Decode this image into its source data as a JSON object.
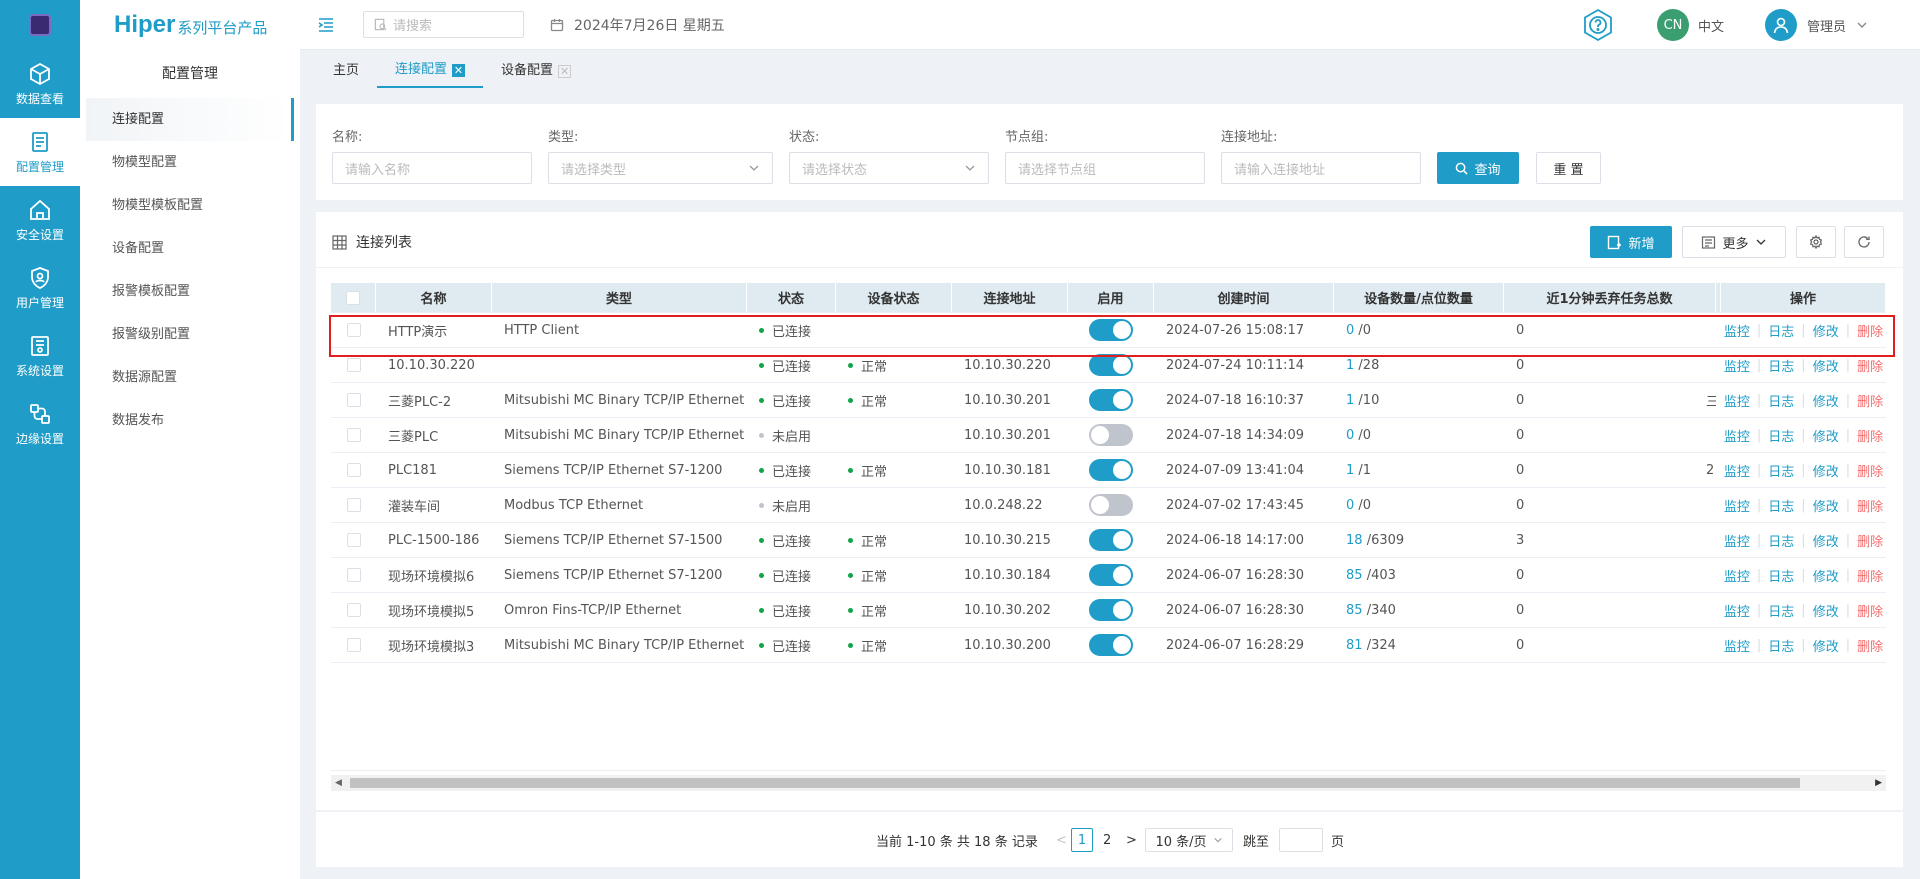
{
  "nav": {
    "items": [
      {
        "label": "数据查看",
        "icon": "cube-icon",
        "active": false
      },
      {
        "label": "配置管理",
        "icon": "config-doc-icon",
        "active": true
      },
      {
        "label": "安全设置",
        "icon": "home-shield-icon",
        "active": false
      },
      {
        "label": "用户管理",
        "icon": "user-shield-icon",
        "active": false
      },
      {
        "label": "系统设置",
        "icon": "system-settings-icon",
        "active": false
      },
      {
        "label": "边缘设置",
        "icon": "edge-network-icon",
        "active": false
      }
    ]
  },
  "brand": {
    "name": "Hiper",
    "suffix": "系列平台产品"
  },
  "submenu": {
    "title": "配置管理",
    "items": [
      "连接配置",
      "物模型配置",
      "物模型模板配置",
      "设备配置",
      "报警模板配置",
      "报警级别配置",
      "数据源配置",
      "数据发布"
    ]
  },
  "header": {
    "search_placeholder": "请搜索",
    "date": "2024年7月26日 星期五",
    "lang_badge": "CN",
    "lang_label": "中文",
    "user": "管理员"
  },
  "tabs": [
    {
      "label": "主页",
      "closable": false,
      "active": false
    },
    {
      "label": "连接配置",
      "closable": true,
      "active": true
    },
    {
      "label": "设备配置",
      "closable": true,
      "active": false
    }
  ],
  "filter": {
    "name": {
      "label": "名称:",
      "placeholder": "请输入名称"
    },
    "type": {
      "label": "类型:",
      "placeholder": "请选择类型"
    },
    "status": {
      "label": "状态:",
      "placeholder": "请选择状态"
    },
    "group": {
      "label": "节点组:",
      "placeholder": "请选择节点组"
    },
    "address": {
      "label": "连接地址:",
      "placeholder": "请输入连接地址"
    },
    "query_label": "查询",
    "reset_label": "重 置"
  },
  "list": {
    "title": "连接列表",
    "add_label": "新增",
    "more_label": "更多",
    "columns": [
      "名称",
      "类型",
      "状态",
      "设备状态",
      "连接地址",
      "启用",
      "创建时间",
      "设备数量/点位数量",
      "近1分钟丢弃任务总数",
      "",
      "操作"
    ],
    "ops": [
      "监控",
      "日志",
      "修改",
      "删除"
    ],
    "rows": [
      {
        "name": "HTTP演示",
        "type": "HTTP Client",
        "status": "已连接",
        "device_status": "",
        "address": "",
        "enabled": true,
        "created": "2024-07-26 15:08:17",
        "dev": "0",
        "pts": "/0",
        "dropped": "0",
        "extra": ""
      },
      {
        "name": "10.10.30.220",
        "type": "",
        "status": "已连接",
        "device_status": "正常",
        "address": "10.10.30.220",
        "enabled": true,
        "created": "2024-07-24 10:11:14",
        "dev": "1",
        "pts": "/28",
        "dropped": "0",
        "extra": ""
      },
      {
        "name": "三菱PLC-2",
        "type": "Mitsubishi MC Binary TCP/IP Ethernet",
        "status": "已连接",
        "device_status": "正常",
        "address": "10.10.30.201",
        "enabled": true,
        "created": "2024-07-18 16:10:37",
        "dev": "1",
        "pts": "/10",
        "dropped": "0",
        "extra": "三"
      },
      {
        "name": "三菱PLC",
        "type": "Mitsubishi MC Binary TCP/IP Ethernet",
        "status": "未启用",
        "device_status": "",
        "address": "10.10.30.201",
        "enabled": false,
        "created": "2024-07-18 14:34:09",
        "dev": "0",
        "pts": "/0",
        "dropped": "0",
        "extra": ""
      },
      {
        "name": "PLC181",
        "type": "Siemens TCP/IP Ethernet S7-1200",
        "status": "已连接",
        "device_status": "正常",
        "address": "10.10.30.181",
        "enabled": true,
        "created": "2024-07-09 13:41:04",
        "dev": "1",
        "pts": "/1",
        "dropped": "0",
        "extra": "2"
      },
      {
        "name": "灌装车间",
        "type": "Modbus TCP Ethernet",
        "status": "未启用",
        "device_status": "",
        "address": "10.0.248.22",
        "enabled": false,
        "created": "2024-07-02 17:43:45",
        "dev": "0",
        "pts": "/0",
        "dropped": "0",
        "extra": ""
      },
      {
        "name": "PLC-1500-186",
        "type": "Siemens TCP/IP Ethernet S7-1500",
        "status": "已连接",
        "device_status": "正常",
        "address": "10.10.30.215",
        "enabled": true,
        "created": "2024-06-18 14:17:00",
        "dev": "18",
        "pts": "/6309",
        "dropped": "3",
        "extra": ""
      },
      {
        "name": "现场环境模拟6",
        "type": "Siemens TCP/IP Ethernet S7-1200",
        "status": "已连接",
        "device_status": "正常",
        "address": "10.10.30.184",
        "enabled": true,
        "created": "2024-06-07 16:28:30",
        "dev": "85",
        "pts": "/403",
        "dropped": "0",
        "extra": ""
      },
      {
        "name": "现场环境模拟5",
        "type": "Omron Fins-TCP/IP Ethernet",
        "status": "已连接",
        "device_status": "正常",
        "address": "10.10.30.202",
        "enabled": true,
        "created": "2024-06-07 16:28:30",
        "dev": "85",
        "pts": "/340",
        "dropped": "0",
        "extra": ""
      },
      {
        "name": "现场环境模拟3",
        "type": "Mitsubishi MC Binary TCP/IP Ethernet",
        "status": "已连接",
        "device_status": "正常",
        "address": "10.10.30.200",
        "enabled": true,
        "created": "2024-06-07 16:28:29",
        "dev": "81",
        "pts": "/324",
        "dropped": "0",
        "extra": ""
      }
    ]
  },
  "pagination": {
    "summary": "当前 1-10 条 共 18 条 记录",
    "prev": "<",
    "pages": [
      "1",
      "2"
    ],
    "current": "1",
    "next": ">",
    "page_size": "10 条/页",
    "jump_label": "跳至",
    "page_unit": "页"
  },
  "colors": {
    "accent": "#1f9cc8",
    "success": "#13a34a",
    "muted": "#c0c4cc",
    "danger": "#f56c6c",
    "switch_off": "#c0c4cc"
  }
}
